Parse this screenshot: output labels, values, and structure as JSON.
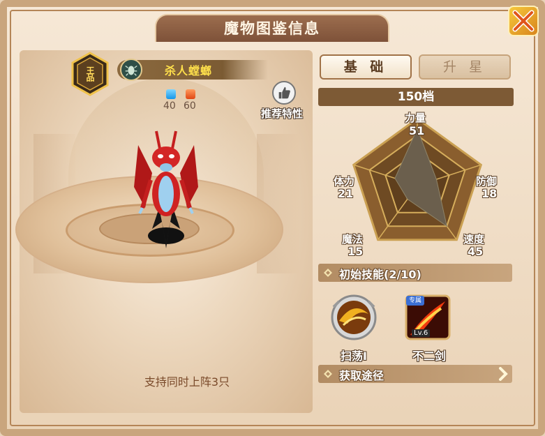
{
  "window": {
    "title": "魔物图鉴信息",
    "close_icon": "close-x-icon"
  },
  "monster": {
    "grade": "王品",
    "name": "杀人螳螂",
    "element_icon": "beetle-emblem-icon",
    "gems": [
      {
        "color": "#1596e8",
        "value": "40"
      },
      {
        "color": "#e04614",
        "value": "60"
      }
    ],
    "recommend_label": "推荐特性",
    "recommend_icon": "thumbs-up-icon",
    "deploy_note": "支持同时上阵3只"
  },
  "tabs": [
    {
      "label": "基 础",
      "active": true
    },
    {
      "label": "升 星",
      "active": false
    }
  ],
  "level_text": "150档",
  "stats": {
    "strength": {
      "label": "力量",
      "value": 51
    },
    "defense": {
      "label": "防御",
      "value": 18
    },
    "speed": {
      "label": "速度",
      "value": 45
    },
    "magic": {
      "label": "魔法",
      "value": 15
    },
    "stamina": {
      "label": "体力",
      "value": 21
    }
  },
  "skills_section": {
    "label": "初始技能(2/10)"
  },
  "skills": [
    {
      "name": "扫荡I"
    },
    {
      "name": "不二剑",
      "badge": "专属",
      "level": "Lv.6"
    }
  ],
  "source_section": {
    "label": "获取途径",
    "arrow_icon": "chevron-right-icon"
  },
  "colors": {
    "name_text": "#ffe04b",
    "frame": "#c9a57d",
    "bar": "#7d5a35"
  }
}
